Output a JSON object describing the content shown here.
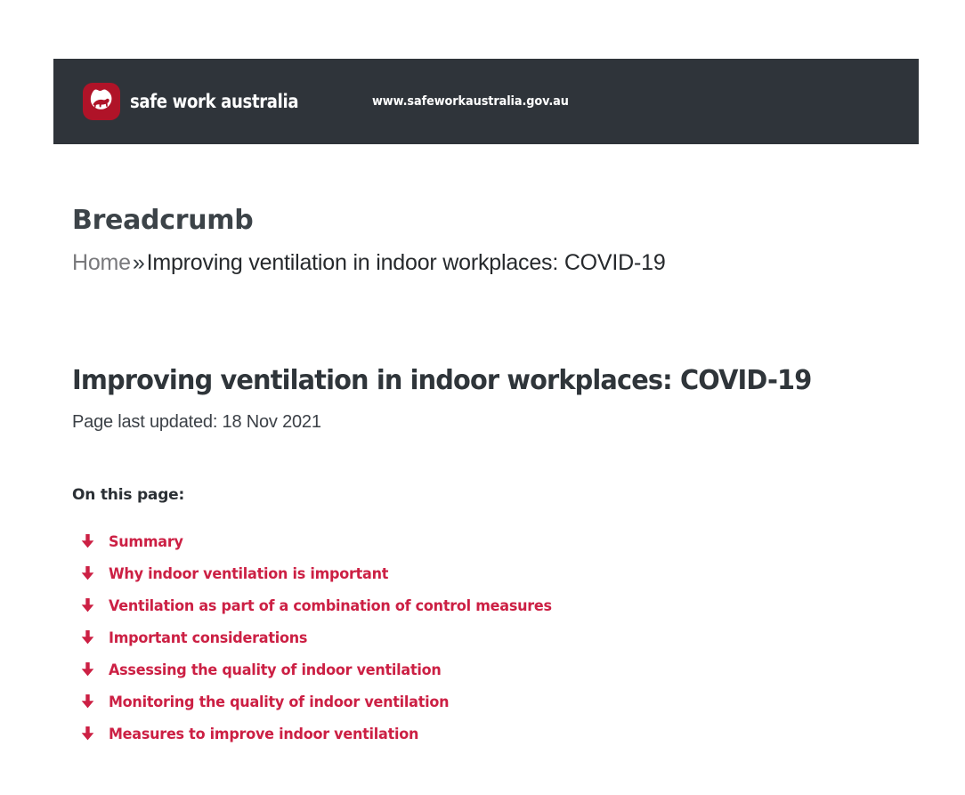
{
  "colors": {
    "header_bg": "#2f343a",
    "accent_red": "#cc2044",
    "logo_red": "#b01328",
    "heading_dark": "#2f353a",
    "muted_gray": "#79797c"
  },
  "header": {
    "logo_icon": "safe-work-australia-logo-icon",
    "wordmark": "safe work australia",
    "url": "www.safeworkaustralia.gov.au"
  },
  "breadcrumb": {
    "heading": "Breadcrumb",
    "home_label": "Home",
    "separator": "»",
    "current_label": "Improving ventilation in indoor workplaces: COVID-19"
  },
  "page": {
    "title": "Improving ventilation in indoor workplaces: COVID-19",
    "last_updated": "Page last updated: 18 Nov 2021",
    "on_this_page_label": "On this page:"
  },
  "on_this_page": {
    "icon": "arrow-down-icon",
    "items": [
      {
        "label": "Summary"
      },
      {
        "label": "Why indoor ventilation is important"
      },
      {
        "label": "Ventilation as part of a combination of control measures"
      },
      {
        "label": "Important considerations"
      },
      {
        "label": "Assessing the quality of indoor ventilation"
      },
      {
        "label": "Monitoring the quality of indoor ventilation"
      },
      {
        "label": "Measures to improve indoor ventilation"
      }
    ]
  }
}
